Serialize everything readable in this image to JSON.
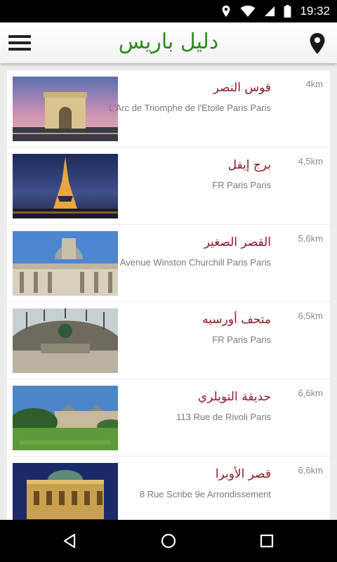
{
  "status_bar": {
    "time": "19:32",
    "icons": [
      "location-icon",
      "wifi-icon",
      "signal-icon",
      "battery-icon"
    ]
  },
  "app_bar": {
    "title": "دليل باريس",
    "left_icon": "hamburger-menu-icon",
    "right_icon": "map-pin-icon"
  },
  "colors": {
    "title_green": "#2e8b1e",
    "place_name": "#8b1a2a",
    "address_gray": "#7a7a7a",
    "distance_gray": "#8a8a8a"
  },
  "places": [
    {
      "name": "قوس النصر",
      "address": "L'Arc de Triomphe de l'Etoile Paris Paris",
      "distance": "4km"
    },
    {
      "name": "برج إيفل",
      "address": "FR Paris Paris",
      "distance": "4,5km"
    },
    {
      "name": "القصر الصغير",
      "address": "Avenue Winston Churchill Paris Paris",
      "distance": "5,6km"
    },
    {
      "name": "متحف أورسيه",
      "address": "FR Paris Paris",
      "distance": "6,5km"
    },
    {
      "name": "حديقة التويلري",
      "address": "113 Rue de Rivoli Paris",
      "distance": "6,6km"
    },
    {
      "name": "قصر الأوبرا",
      "address": "8 Rue Scribe 9e Arrondissement",
      "distance": "6,6km"
    }
  ],
  "nav_bar": {
    "buttons": [
      "back-icon",
      "home-icon",
      "recents-icon"
    ]
  }
}
